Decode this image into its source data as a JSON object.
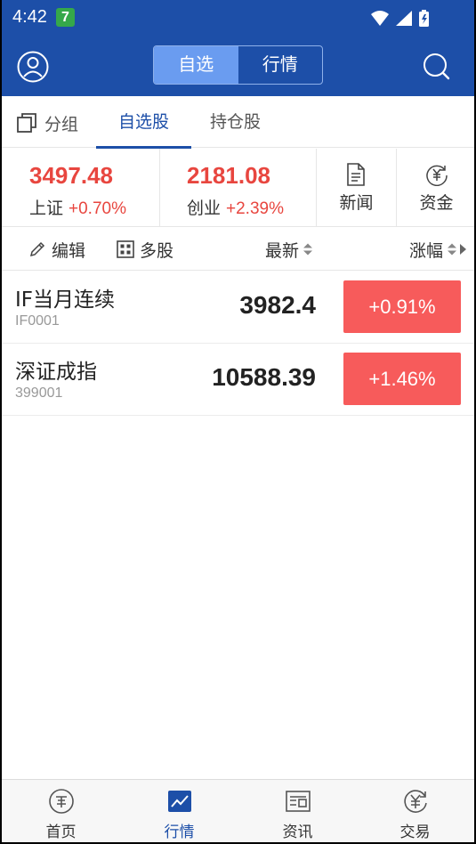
{
  "status_bar": {
    "time": "4:42",
    "app_badge": "7"
  },
  "nav": {
    "segments": [
      {
        "label": "自选",
        "active": true
      },
      {
        "label": "行情",
        "active": false
      }
    ]
  },
  "sub_tabs": {
    "group_label": "分组",
    "tabs": [
      {
        "label": "自选股",
        "active": true
      },
      {
        "label": "持仓股",
        "active": false
      }
    ]
  },
  "indices": [
    {
      "value": "3497.48",
      "name": "上证",
      "change": "+0.70%"
    },
    {
      "value": "2181.08",
      "name": "创业",
      "change": "+2.39%"
    }
  ],
  "quick_actions": [
    {
      "label": "新闻",
      "icon": "news-icon"
    },
    {
      "label": "资金",
      "icon": "capital-icon"
    }
  ],
  "toolbar": {
    "edit_label": "编辑",
    "multi_label": "多股",
    "col_latest": "最新",
    "col_change": "涨幅"
  },
  "watchlist": [
    {
      "name": "IF当月连续",
      "code": "IF0001",
      "price": "3982.4",
      "change": "+0.91%"
    },
    {
      "name": "深证成指",
      "code": "399001",
      "price": "10588.39",
      "change": "+1.46%"
    }
  ],
  "bottom_nav": [
    {
      "label": "首页",
      "icon": "coupon-icon",
      "active": false
    },
    {
      "label": "行情",
      "icon": "chart-icon",
      "active": true
    },
    {
      "label": "资讯",
      "icon": "info-card-icon",
      "active": false
    },
    {
      "label": "交易",
      "icon": "yuan-exchange-icon",
      "active": false
    }
  ],
  "colors": {
    "brand": "#1d4fa8",
    "up": "#e8463f",
    "up_badge": "#f75b5b"
  }
}
